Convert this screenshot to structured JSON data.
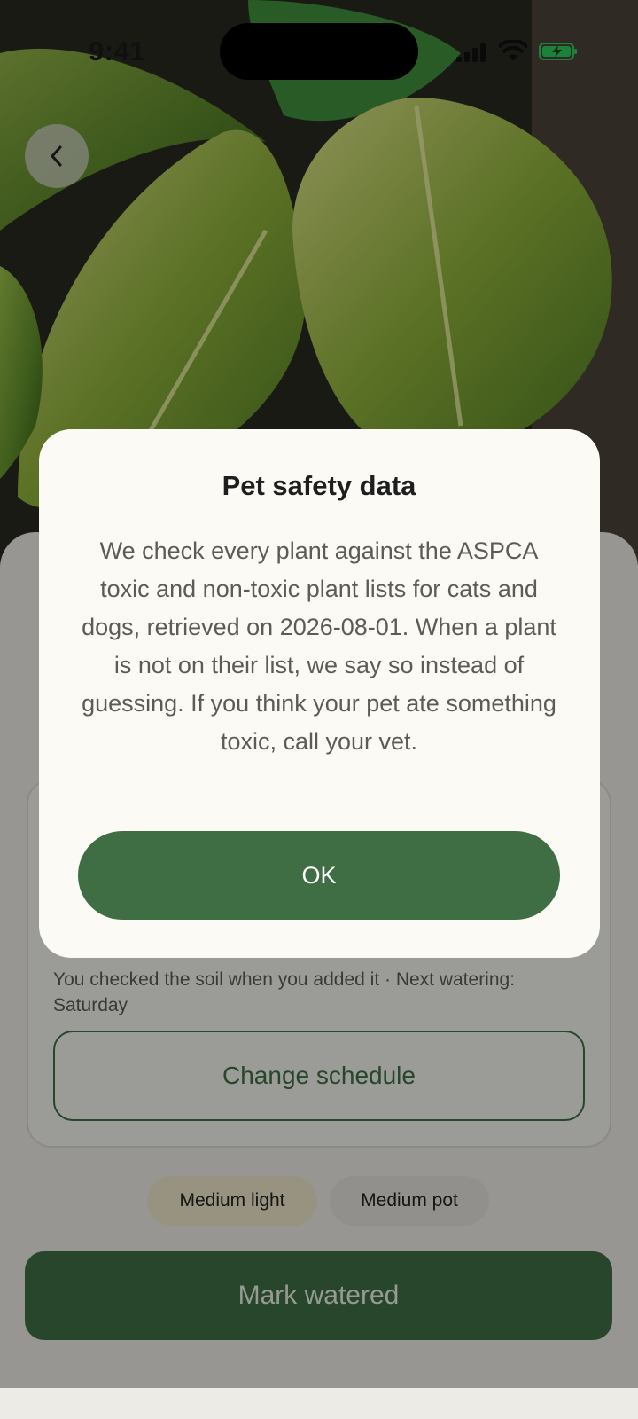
{
  "status_bar": {
    "time": "9:41"
  },
  "header": {
    "back_icon": "chevron-left-icon",
    "photo_alt": "Golden pothos plant leaves"
  },
  "care": {
    "schedule_text": "You checked the soil when you added it · Next watering: Saturday",
    "change_schedule_label": "Change schedule"
  },
  "chips": [
    {
      "label": "Medium light",
      "color": "#ece6c9"
    },
    {
      "label": "Medium pot",
      "color": "#e5e2db"
    }
  ],
  "actions": {
    "mark_watered_label": "Mark watered"
  },
  "dialog": {
    "title": "Pet safety data",
    "body": "We check every plant against the ASPCA toxic and non-toxic plant lists for cats and dogs, retrieved on 2026-08-01. When a plant is not on their list, we say so instead of guessing. If you think your pet ate something toxic, call your vet.",
    "ok_label": "OK"
  },
  "colors": {
    "accent": "#3f6e44",
    "dialog_bg": "#fcfaf5",
    "battery": "#2ecc5a"
  }
}
